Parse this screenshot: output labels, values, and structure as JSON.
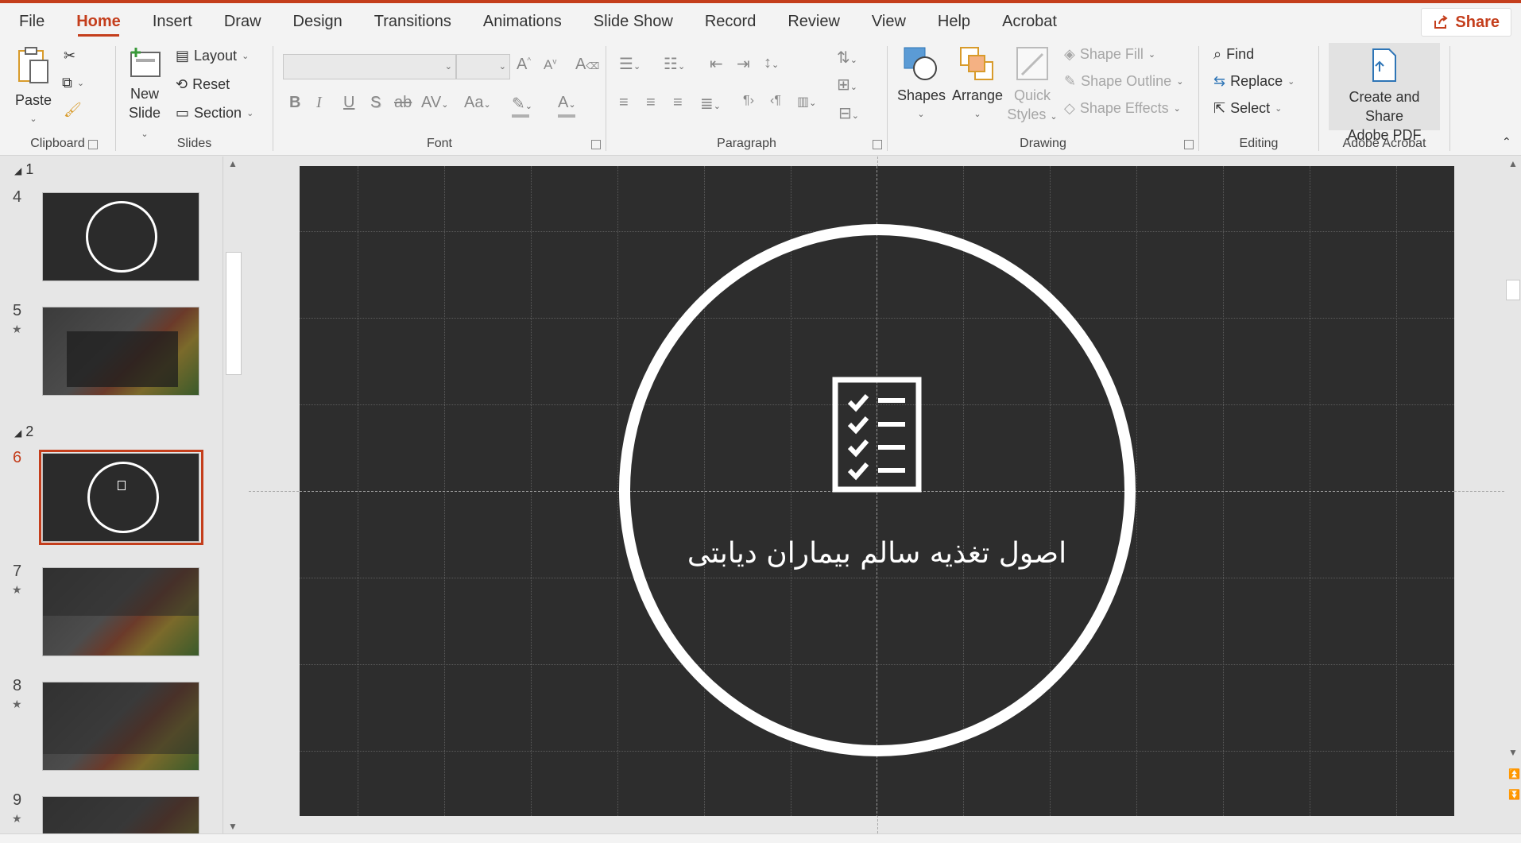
{
  "tabs": [
    "File",
    "Home",
    "Insert",
    "Draw",
    "Design",
    "Transitions",
    "Animations",
    "Slide Show",
    "Record",
    "Review",
    "View",
    "Help",
    "Acrobat"
  ],
  "active_tab": "Home",
  "share_label": "Share",
  "ribbon": {
    "clipboard": {
      "label": "Clipboard",
      "paste": "Paste"
    },
    "slides": {
      "label": "Slides",
      "new_slide_1": "New",
      "new_slide_2": "Slide",
      "layout": "Layout",
      "reset": "Reset",
      "section": "Section"
    },
    "font": {
      "label": "Font",
      "bold": "B",
      "italic": "I",
      "underline": "U",
      "shadow": "S",
      "strike": "ab",
      "spacing": "AV",
      "case": "Aa",
      "font_color": "A"
    },
    "paragraph": {
      "label": "Paragraph"
    },
    "drawing": {
      "label": "Drawing",
      "shapes": "Shapes",
      "arrange": "Arrange",
      "quick_styles_1": "Quick",
      "quick_styles_2": "Styles",
      "shape_fill": "Shape Fill",
      "shape_outline": "Shape Outline",
      "shape_effects": "Shape Effects"
    },
    "editing": {
      "label": "Editing",
      "find": "Find",
      "replace": "Replace",
      "select": "Select"
    },
    "acrobat": {
      "label": "Adobe Acrobat",
      "create_1": "Create and Share",
      "create_2": "Adobe PDF"
    }
  },
  "thumbnails": {
    "section_1": "1",
    "section_2": "2",
    "slides": [
      {
        "num": "4",
        "star": false
      },
      {
        "num": "5",
        "star": true
      },
      {
        "num": "6",
        "star": false,
        "active": true
      },
      {
        "num": "7",
        "star": true
      },
      {
        "num": "8",
        "star": true
      },
      {
        "num": "9",
        "star": true
      }
    ],
    "star_glyph": "★"
  },
  "slide": {
    "title": "اصول تغذیه سالم بیماران دیابتی",
    "icon": "checklist-icon",
    "background": "#2d2d2d"
  },
  "colors": {
    "accent": "#c43e1c"
  }
}
